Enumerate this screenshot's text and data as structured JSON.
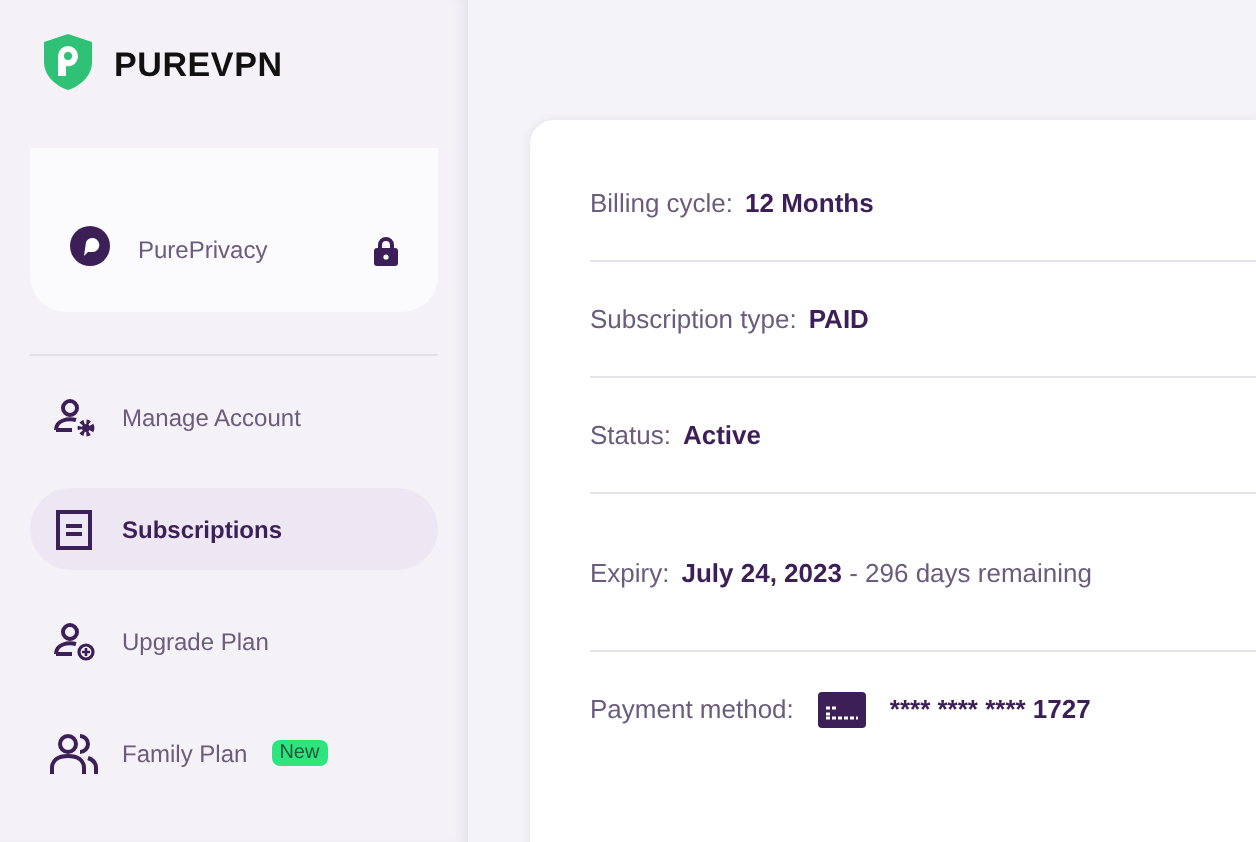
{
  "brand": {
    "name": "PUREVPN"
  },
  "addons": [
    {
      "label": "PurePrivacy",
      "locked": true
    }
  ],
  "menu": [
    {
      "label": "Manage Account",
      "selected": false
    },
    {
      "label": "Subscriptions",
      "selected": true
    },
    {
      "label": "Upgrade Plan",
      "selected": false
    },
    {
      "label": "Family Plan",
      "selected": false,
      "badge": "New"
    }
  ],
  "details": [
    {
      "kind": "text",
      "label": "Billing cycle:",
      "value": "12 Months"
    },
    {
      "kind": "text",
      "label": "Subscription type:",
      "value": "PAID"
    },
    {
      "kind": "text",
      "label": "Status:",
      "value": "Active"
    },
    {
      "kind": "text",
      "label": "Expiry:",
      "value": "**July 24, 2023** - 296 days remaining"
    },
    {
      "kind": "card",
      "label": "Payment method:",
      "value": "**** **** **** 1727"
    }
  ]
}
